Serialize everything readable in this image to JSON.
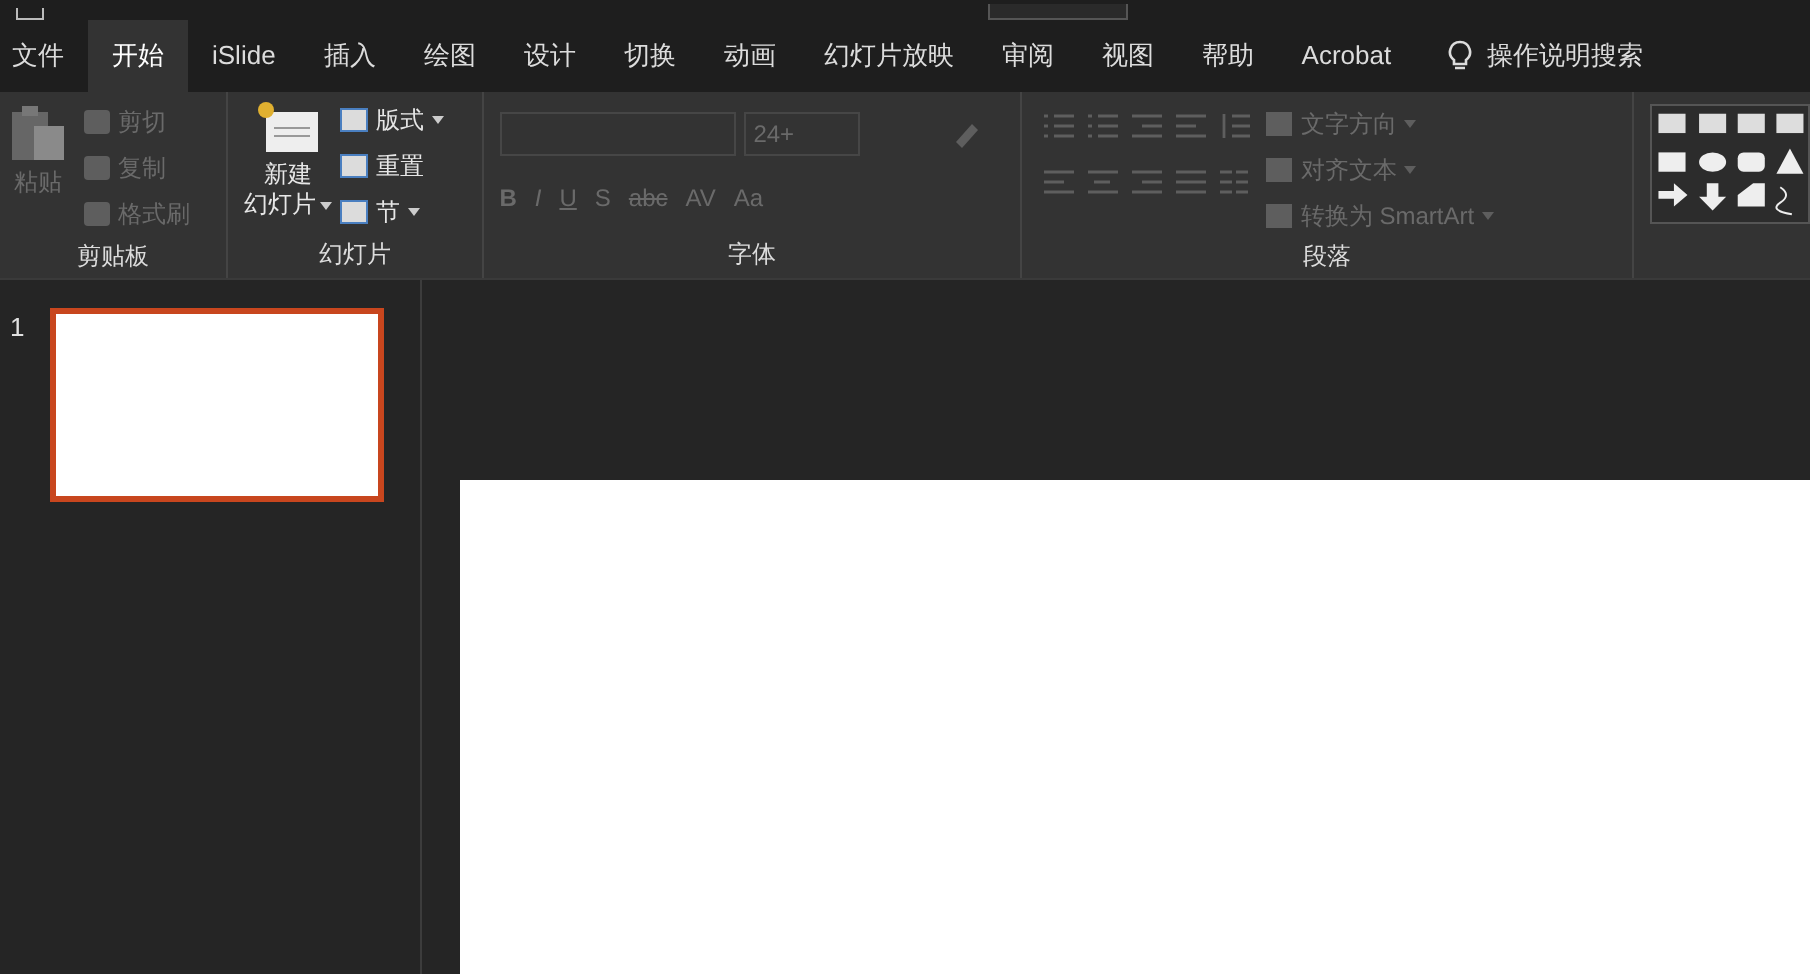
{
  "tabs": [
    {
      "label": "文件",
      "selected": false
    },
    {
      "label": "开始",
      "selected": true
    },
    {
      "label": "iSlide",
      "selected": false
    },
    {
      "label": "插入",
      "selected": false
    },
    {
      "label": "绘图",
      "selected": false
    },
    {
      "label": "设计",
      "selected": false
    },
    {
      "label": "切换",
      "selected": false
    },
    {
      "label": "动画",
      "selected": false
    },
    {
      "label": "幻灯片放映",
      "selected": false
    },
    {
      "label": "审阅",
      "selected": false
    },
    {
      "label": "视图",
      "selected": false
    },
    {
      "label": "帮助",
      "selected": false
    },
    {
      "label": "Acrobat",
      "selected": false
    }
  ],
  "search": {
    "label": "操作说明搜索"
  },
  "clipboard": {
    "title": "剪贴板",
    "paste": {
      "label": "粘贴",
      "disabled": true
    },
    "items": [
      {
        "label": "剪切",
        "disabled": true
      },
      {
        "label": "复制",
        "disabled": true
      },
      {
        "label": "格式刷",
        "disabled": true
      }
    ]
  },
  "slides": {
    "title": "幻灯片",
    "new_slide": {
      "label_1": "新建",
      "label_2": "幻灯片"
    },
    "items": [
      {
        "label": "版式",
        "dropdown": true
      },
      {
        "label": "重置",
        "dropdown": false
      },
      {
        "label": "节",
        "dropdown": true
      }
    ]
  },
  "font": {
    "title": "字体",
    "size": "24+",
    "disabled": true,
    "buttons": [
      {
        "label": "B",
        "kind": "bold"
      },
      {
        "label": "I",
        "kind": "italic"
      },
      {
        "label": "U",
        "kind": "underline"
      },
      {
        "label": "S",
        "kind": "plain"
      },
      {
        "label": "abc",
        "kind": "strike"
      },
      {
        "label": "AV",
        "kind": "plain"
      },
      {
        "label": "Aa",
        "kind": "plain"
      }
    ]
  },
  "paragraph": {
    "title": "段落",
    "disabled": true,
    "items": [
      {
        "label": "文字方向"
      },
      {
        "label": "对齐文本"
      },
      {
        "label": "转换为 SmartArt"
      }
    ]
  },
  "slide_list": [
    {
      "number": "1",
      "selected": true
    }
  ]
}
